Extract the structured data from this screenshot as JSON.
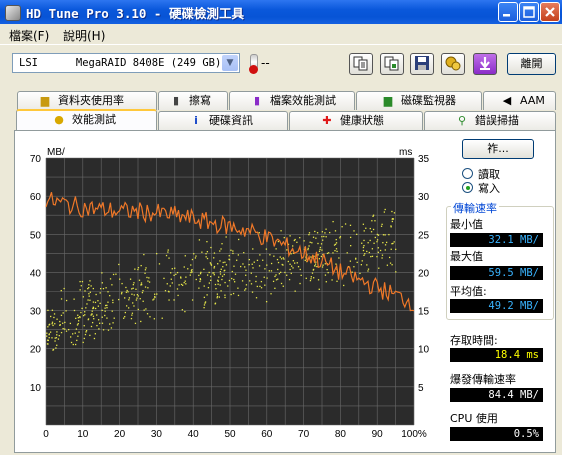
{
  "window": {
    "title": "HD Tune Pro 3.10 - 硬碟檢測工具"
  },
  "menu": [
    {
      "label": "檔案(F)"
    },
    {
      "label": "說明(H)"
    }
  ],
  "toolbar": {
    "drive": "LSI      MegaRAID 8408E (249 GB)",
    "temperature": "--",
    "exit_label": "離開",
    "icons": [
      "copy-text-icon",
      "copy-image-icon",
      "save-icon",
      "options-icon",
      "download-icon"
    ]
  },
  "tabs_top": [
    {
      "label": "資料夾使用率",
      "icon": "folder-icon"
    },
    {
      "label": "擦寫",
      "icon": "trash-icon"
    },
    {
      "label": "檔案效能測試",
      "icon": "file-benchmark-icon"
    },
    {
      "label": "磁碟監視器",
      "icon": "monitor-icon"
    },
    {
      "label": "AAM",
      "icon": "speaker-icon"
    }
  ],
  "tabs_bottom": [
    {
      "label": "效能測試",
      "icon": "lightbulb-icon",
      "active": true
    },
    {
      "label": "硬碟資訊",
      "icon": "info-icon"
    },
    {
      "label": "健康狀態",
      "icon": "health-cross-icon"
    },
    {
      "label": "錯誤掃描",
      "icon": "magnifier-icon"
    }
  ],
  "controls": {
    "start_label": "祚...",
    "read_label": "讀取",
    "write_label": "寫入",
    "selected": "write"
  },
  "stats": {
    "transfer_title": "傳輸速率",
    "min_label": "最小值",
    "min_value": "32.1 MB/",
    "max_label": "最大值",
    "max_value": "59.5 MB/",
    "avg_label": "平均值:",
    "avg_value": "49.2 MB/",
    "access_label": "存取時間:",
    "access_value": "18.4 ms",
    "burst_label": "爆發傳輸速率",
    "burst_value": "84.4 MB/",
    "cpu_label": "CPU 使用",
    "cpu_value": "0.5%"
  },
  "colors": {
    "titlebar": "#0A58DB",
    "chart_bg": "#2B2B2B",
    "transfer_line": "#F07828",
    "access_points": "#E8E84A",
    "grid": "#6A6A6A"
  },
  "chart_data": {
    "type": "line",
    "left_unit": "MB/",
    "right_unit": "ms",
    "x_ticks": [
      "0",
      "10",
      "20",
      "30",
      "40",
      "50",
      "60",
      "70",
      "80",
      "90",
      "100%"
    ],
    "y_left_ticks": [
      "10",
      "20",
      "30",
      "40",
      "50",
      "60",
      "70"
    ],
    "y_right_ticks": [
      "5",
      "10",
      "15",
      "20",
      "25",
      "30",
      "35"
    ],
    "xlim": [
      0,
      100
    ],
    "ylim_left": [
      0,
      70
    ],
    "ylim_right": [
      0,
      35
    ],
    "grid": true,
    "series": [
      {
        "unit": "MB/",
        "x": [
          0,
          5,
          10,
          15,
          20,
          25,
          30,
          35,
          40,
          45,
          50,
          55,
          60,
          65,
          70,
          75,
          80,
          85,
          90,
          95,
          100
        ],
        "values": [
          59,
          58,
          57,
          56.5,
          56,
          56,
          55.5,
          55,
          54,
          53,
          52,
          51,
          49,
          47,
          45,
          43,
          40,
          38,
          36,
          34,
          32
        ]
      },
      {
        "unit": "ms",
        "type": "scatter",
        "trend_x": [
          0,
          10,
          20,
          30,
          40,
          50,
          60,
          70,
          80,
          90,
          95
        ],
        "trend_values": [
          12,
          15,
          17,
          18.5,
          19.5,
          20.5,
          21,
          22,
          23,
          24,
          25
        ],
        "spread_ms": 5
      }
    ]
  }
}
